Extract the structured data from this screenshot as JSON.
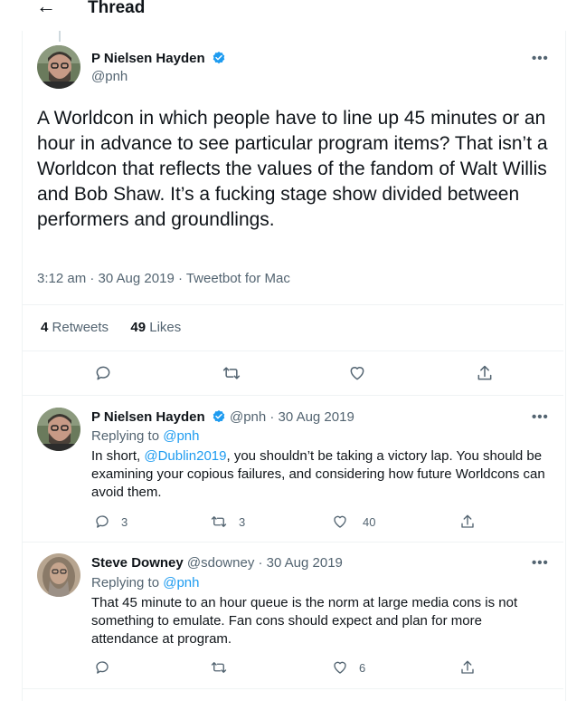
{
  "header": {
    "title": "Thread",
    "back_glyph": "←"
  },
  "main_tweet": {
    "display_name": "P Nielsen Hayden",
    "handle": "@pnh",
    "verified": true,
    "more_glyph": "•••",
    "text": "A Worldcon in which people have to line up 45 minutes or an hour in advance to see particular program items? That isn’t a Worldcon that reflects the values of the fandom of Walt Willis and Bob Shaw. It’s a fucking stage show divided between performers and groundlings.",
    "meta": "3:12 am · 30 Aug 2019 · Tweetbot for Mac",
    "retweets_count": "4",
    "retweets_label": "Retweets",
    "likes_count": "49",
    "likes_label": "Likes"
  },
  "replies": [
    {
      "display_name": "P Nielsen Hayden",
      "handle_date": "@pnh · 30 Aug 2019",
      "verified": true,
      "more_glyph": "•••",
      "replying_label": "Replying to",
      "replying_handle": "@pnh",
      "text_before": "In short, ",
      "mention": "@Dublin2019",
      "text_after": ", you shouldn’t be taking a victory lap. You should be examining your copious failures, and considering how future Worldcons can avoid them.",
      "reply_count": "3",
      "retweet_count": "3",
      "like_count": "40"
    },
    {
      "display_name": "Steve Downey",
      "handle_date": "@sdowney · 30 Aug 2019",
      "verified": false,
      "more_glyph": "•••",
      "replying_label": "Replying to",
      "replying_handle": "@pnh",
      "text": "That 45 minute to an hour queue is the norm at large media cons is not something to emulate. Fan cons should expect and plan for more attendance at program.",
      "reply_count": "",
      "retweet_count": "",
      "like_count": "6"
    }
  ],
  "colors": {
    "text": "#0f1419",
    "secondary": "#536471",
    "link": "#1d9bf0",
    "divider": "#eff3f4",
    "verified_badge": "#1d9bf0"
  }
}
